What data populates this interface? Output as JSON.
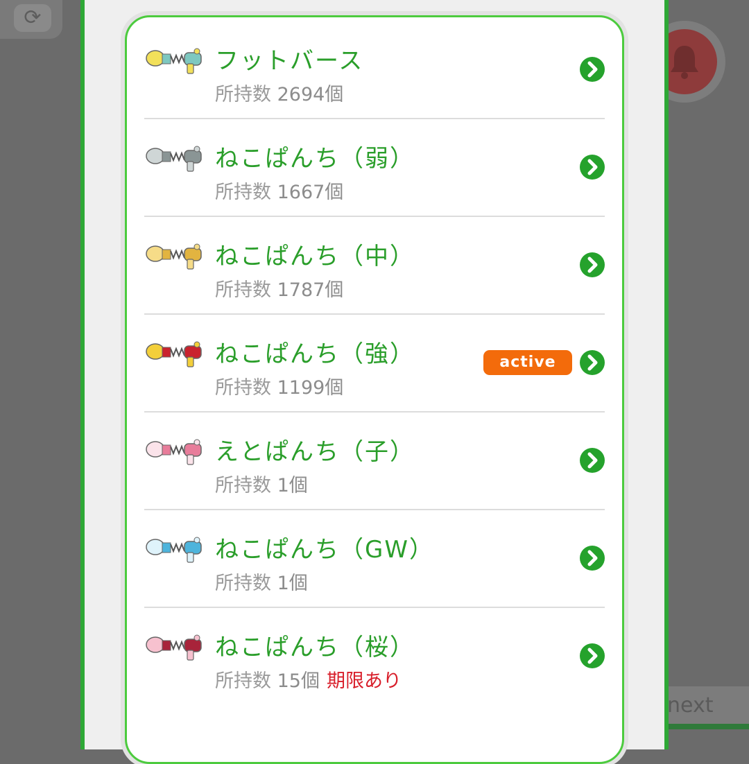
{
  "background": {
    "next_label": "next"
  },
  "list": {
    "count_label": "所持数",
    "items": [
      {
        "name": "フットバース",
        "count": "2694個",
        "expiry": "",
        "badge": "",
        "icon": "gauntlet-yellow-icon",
        "colors": {
          "a": "#f2e05a",
          "b": "#7ec8c0"
        }
      },
      {
        "name": "ねこぱんち（弱）",
        "count": "1667個",
        "expiry": "",
        "badge": "",
        "icon": "cat-punch-gray-icon",
        "colors": {
          "a": "#cfd6d6",
          "b": "#8a9595"
        }
      },
      {
        "name": "ねこぱんち（中）",
        "count": "1787個",
        "expiry": "",
        "badge": "",
        "icon": "cat-punch-gold-icon",
        "colors": {
          "a": "#f6dc88",
          "b": "#e2b440"
        }
      },
      {
        "name": "ねこぱんち（強）",
        "count": "1199個",
        "expiry": "",
        "badge": "active",
        "icon": "cat-punch-red-icon",
        "colors": {
          "a": "#f3cf3a",
          "b": "#c9232e"
        }
      },
      {
        "name": "えとぱんち（子）",
        "count": "1個",
        "expiry": "",
        "badge": "",
        "icon": "mouse-punch-pink-icon",
        "colors": {
          "a": "#fbe3ea",
          "b": "#e87c9a"
        }
      },
      {
        "name": "ねこぱんち（GW）",
        "count": "1個",
        "expiry": "",
        "badge": "",
        "icon": "cat-punch-blue-icon",
        "colors": {
          "a": "#dff3fb",
          "b": "#4db4dc"
        }
      },
      {
        "name": "ねこぱんち（桜）",
        "count": "15個",
        "expiry": "期限あり",
        "badge": "",
        "icon": "cat-punch-sakura-icon",
        "colors": {
          "a": "#f7c1cf",
          "b": "#a8233a"
        }
      }
    ]
  },
  "colors": {
    "accent_green": "#25a22c",
    "name_green": "#2a9e2a",
    "badge_orange": "#f36b0b",
    "expiry_red": "#d81e2a"
  }
}
